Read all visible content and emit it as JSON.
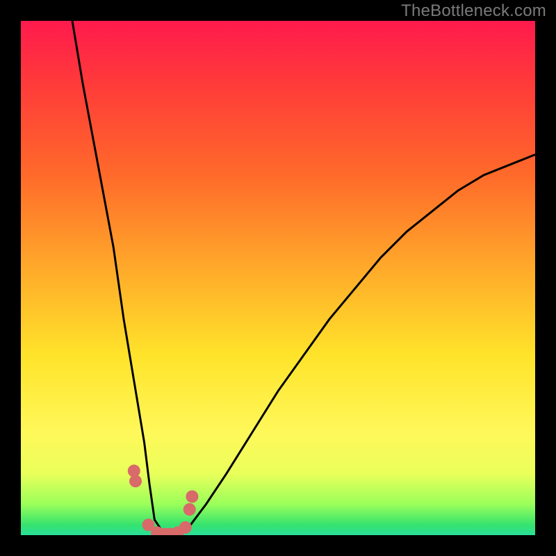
{
  "watermark": "TheBottleneck.com",
  "chart_data": {
    "type": "line",
    "title": "",
    "xlabel": "",
    "ylabel": "",
    "xlim": [
      0,
      100
    ],
    "ylim": [
      0,
      100
    ],
    "background_gradient": {
      "top": "#ff1a4d",
      "bottom": "#2adf9a",
      "meaning": "red=bad, green=good"
    },
    "series": [
      {
        "name": "bottleneck-curve",
        "color": "#000000",
        "x": [
          10,
          12,
          15,
          18,
          20,
          22,
          24,
          25,
          26,
          28,
          30,
          33,
          36,
          40,
          45,
          50,
          55,
          60,
          65,
          70,
          75,
          80,
          85,
          90,
          95,
          100
        ],
        "values": [
          100,
          88,
          72,
          56,
          42,
          30,
          18,
          10,
          3,
          0,
          0,
          2,
          6,
          12,
          20,
          28,
          35,
          42,
          48,
          54,
          59,
          63,
          67,
          70,
          72,
          74
        ]
      },
      {
        "name": "marker-dots",
        "color": "#d86a6a",
        "x": [
          22.0,
          22.3,
          24.8,
          26.5,
          28.0,
          29.0,
          30.5,
          32.0,
          32.8,
          33.3
        ],
        "values": [
          12.5,
          10.5,
          2.0,
          0.5,
          0.2,
          0.2,
          0.5,
          1.5,
          5.0,
          7.5
        ]
      }
    ]
  }
}
